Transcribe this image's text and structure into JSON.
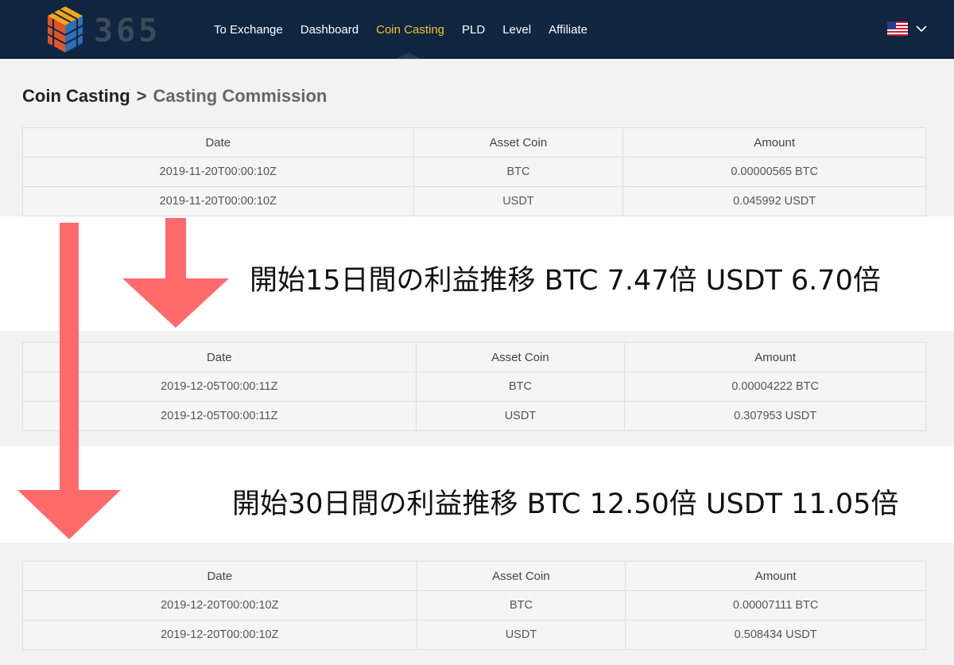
{
  "header": {
    "logo_text": "365",
    "nav": [
      "To Exchange",
      "Dashboard",
      "Coin Casting",
      "PLD",
      "Level",
      "Affiliate"
    ],
    "active_nav": "Coin Casting",
    "language_icon": "us-flag-icon"
  },
  "breadcrumb": {
    "parent": "Coin Casting",
    "separator": ">",
    "current": "Casting Commission"
  },
  "tables": [
    {
      "columns": [
        "Date",
        "Asset Coin",
        "Amount"
      ],
      "rows": [
        [
          "2019-11-20T00:00:10Z",
          "BTC",
          "0.00000565 BTC"
        ],
        [
          "2019-11-20T00:00:10Z",
          "USDT",
          "0.045992 USDT"
        ]
      ]
    },
    {
      "columns": [
        "Date",
        "Asset Coin",
        "Amount"
      ],
      "rows": [
        [
          "2019-12-05T00:00:11Z",
          "BTC",
          "0.00004222 BTC"
        ],
        [
          "2019-12-05T00:00:11Z",
          "USDT",
          "0.307953 USDT"
        ]
      ]
    },
    {
      "columns": [
        "Date",
        "Asset Coin",
        "Amount"
      ],
      "rows": [
        [
          "2019-12-20T00:00:10Z",
          "BTC",
          "0.00007111 BTC"
        ],
        [
          "2019-12-20T00:00:10Z",
          "USDT",
          "0.508434 USDT"
        ]
      ]
    }
  ],
  "annotations": {
    "note_15": "開始15日間の利益推移  BTC 7.47倍   USDT 6.70倍",
    "note_30": "開始30日間の利益推移  BTC 12.50倍   USDT 11.05倍",
    "arrow_color": "#ff6b6b"
  },
  "colors": {
    "header_bg": "#0f2540",
    "active_nav": "#f0c430",
    "page_bg": "#f2f2f2"
  }
}
